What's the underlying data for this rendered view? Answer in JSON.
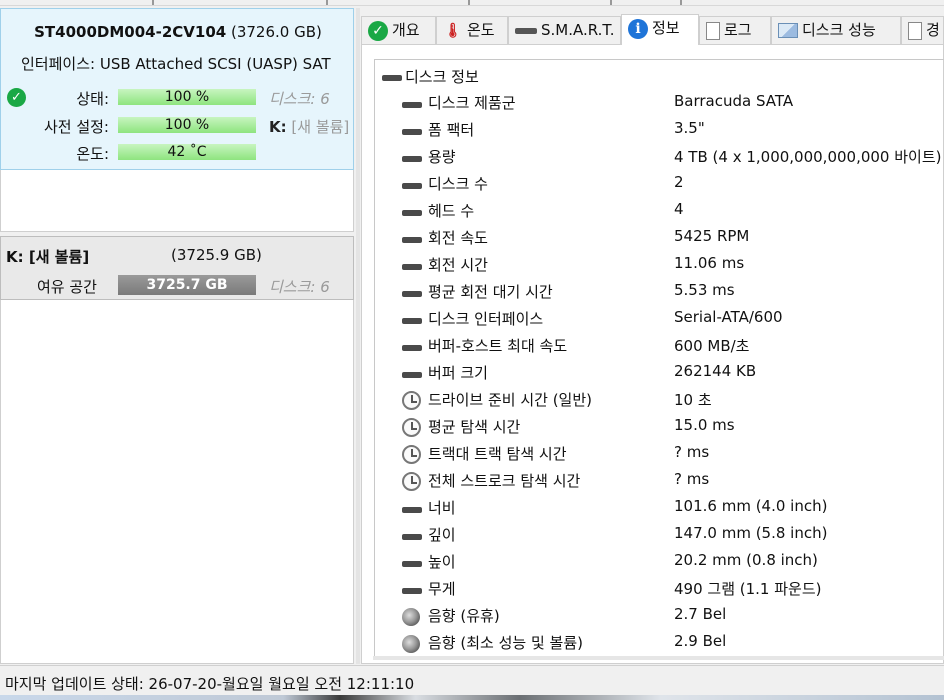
{
  "disk": {
    "model": "ST4000DM004-2CV104",
    "capacity": "(3726.0 GB)",
    "interface_label": "인터페이스:",
    "interface_value": "USB Attached SCSI (UASP) SAT",
    "status_label": "상태:",
    "status_value": "100 %",
    "status_note": "디스크: 6",
    "preset_label": "사전 설정:",
    "preset_value": "100 %",
    "preset_note_drive": "K:",
    "preset_note_name": "[새 볼륨]",
    "temp_label": "온도:",
    "temp_value": "42 ˚C"
  },
  "volume": {
    "title": "K: [새 볼륨]",
    "size": "(3725.9 GB)",
    "free_label": "여유 공간",
    "free_value": "3725.7 GB",
    "free_note": "디스크: 6"
  },
  "tabs": [
    {
      "label": "개요",
      "icon": "check-icon"
    },
    {
      "label": "온도",
      "icon": "thermometer-icon"
    },
    {
      "label": "S.M.A.R.T.",
      "icon": "disk-icon"
    },
    {
      "label": "정보",
      "icon": "info-icon"
    },
    {
      "label": "로그",
      "icon": "document-icon"
    },
    {
      "label": "디스크 성능",
      "icon": "chart-icon"
    },
    {
      "label": "경",
      "icon": "copy-icon"
    }
  ],
  "info": {
    "root": "디스크 정보",
    "rows": [
      {
        "key": "디스크 제품군",
        "value": "Barracuda SATA",
        "icon": "disk-icon"
      },
      {
        "key": "폼 팩터",
        "value": "3.5\"",
        "icon": "disk-icon"
      },
      {
        "key": "용량",
        "value": "4 TB (4 x 1,000,000,000,000 바이트)",
        "icon": "disk-icon"
      },
      {
        "key": "디스크 수",
        "value": "2",
        "icon": "disk-icon"
      },
      {
        "key": "헤드 수",
        "value": "4",
        "icon": "disk-icon"
      },
      {
        "key": "회전 속도",
        "value": "5425 RPM",
        "icon": "disk-icon"
      },
      {
        "key": "회전 시간",
        "value": "11.06 ms",
        "icon": "disk-icon"
      },
      {
        "key": "평균 회전 대기 시간",
        "value": "5.53 ms",
        "icon": "disk-icon"
      },
      {
        "key": "디스크 인터페이스",
        "value": "Serial-ATA/600",
        "icon": "disk-icon"
      },
      {
        "key": "버퍼-호스트 최대 속도",
        "value": "600 MB/초",
        "icon": "disk-icon"
      },
      {
        "key": "버퍼 크기",
        "value": "262144 KB",
        "icon": "disk-icon"
      },
      {
        "key": "드라이브 준비 시간 (일반)",
        "value": "10 초",
        "icon": "clock-icon"
      },
      {
        "key": "평균 탐색 시간",
        "value": "15.0 ms",
        "icon": "clock-icon"
      },
      {
        "key": "트랙대 트랙 탐색 시간",
        "value": "? ms",
        "icon": "clock-icon"
      },
      {
        "key": "전체 스트로크 탐색 시간",
        "value": "? ms",
        "icon": "clock-icon"
      },
      {
        "key": "너비",
        "value": "101.6 mm (4.0 inch)",
        "icon": "disk-icon"
      },
      {
        "key": "깊이",
        "value": "147.0 mm (5.8 inch)",
        "icon": "disk-icon"
      },
      {
        "key": "높이",
        "value": "20.2 mm (0.8 inch)",
        "icon": "disk-icon"
      },
      {
        "key": "무게",
        "value": "490 그램 (1.1 파운드)",
        "icon": "disk-icon"
      },
      {
        "key": "음향 (유휴)",
        "value": "2.7 Bel",
        "icon": "speaker-icon"
      },
      {
        "key": "음향 (최소 성능 및 볼륨)",
        "value": "2.9 Bel",
        "icon": "speaker-icon"
      }
    ]
  },
  "status_bar": {
    "text": "마지막 업데이트 상태: 26-07-20-월요일 월요일 오전 12:11:10"
  }
}
